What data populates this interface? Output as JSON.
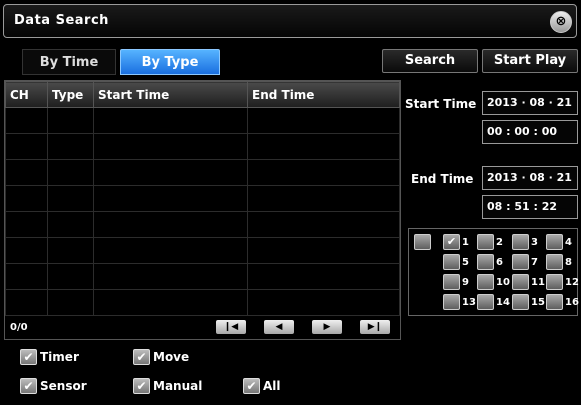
{
  "window": {
    "title": "Data Search",
    "close_symbol": "⊗"
  },
  "tabs": {
    "by_time": "By Time",
    "by_type": "By Type"
  },
  "buttons": {
    "search": "Search",
    "start_play": "Start Play"
  },
  "table": {
    "columns": [
      "CH",
      "Type",
      "Start Time",
      "End Time"
    ],
    "counter": "0/0",
    "nav": {
      "first": "❙◀",
      "prev": "◀",
      "next": "▶",
      "last": "▶❙"
    }
  },
  "filters": {
    "timer": {
      "label": "Timer",
      "checked": true
    },
    "move": {
      "label": "Move",
      "checked": true
    },
    "sensor": {
      "label": "Sensor",
      "checked": true
    },
    "manual": {
      "label": "Manual",
      "checked": true
    },
    "all": {
      "label": "All",
      "checked": true
    },
    "check_mark": "✔"
  },
  "range": {
    "start_label": "Start Time",
    "start_date": "2013 · 08 · 21",
    "start_time": "00 : 00 : 00",
    "end_label": "End Time",
    "end_date": "2013 · 08 · 21",
    "end_time": "08 : 51 : 22"
  },
  "channels": {
    "all_checked": false,
    "items": [
      {
        "label": "1",
        "checked": true
      },
      {
        "label": "2",
        "checked": false
      },
      {
        "label": "3",
        "checked": false
      },
      {
        "label": "4",
        "checked": false
      },
      {
        "label": "5",
        "checked": false
      },
      {
        "label": "6",
        "checked": false
      },
      {
        "label": "7",
        "checked": false
      },
      {
        "label": "8",
        "checked": false
      },
      {
        "label": "9",
        "checked": false
      },
      {
        "label": "10",
        "checked": false
      },
      {
        "label": "11",
        "checked": false
      },
      {
        "label": "12",
        "checked": false
      },
      {
        "label": "13",
        "checked": false
      },
      {
        "label": "14",
        "checked": false
      },
      {
        "label": "15",
        "checked": false
      },
      {
        "label": "16",
        "checked": false
      }
    ]
  }
}
